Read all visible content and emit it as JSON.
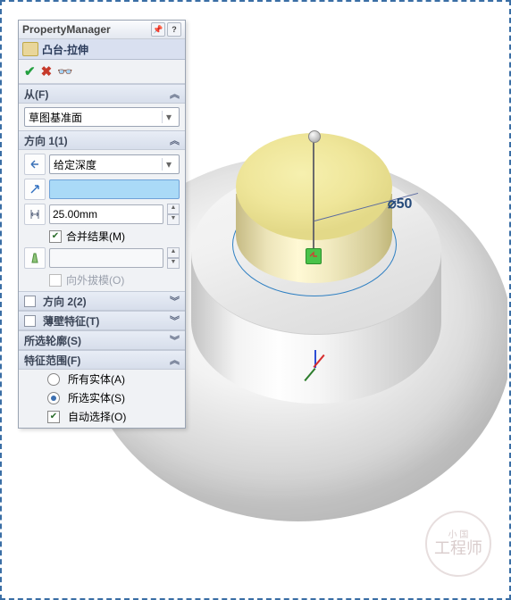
{
  "header": {
    "title": "PropertyManager"
  },
  "feature": {
    "title": "凸台-拉伸"
  },
  "from": {
    "label": "从(F)",
    "selected": "草图基准面"
  },
  "dir1": {
    "label": "方向 1(1)",
    "end_condition": "给定深度",
    "distance": "25.00mm",
    "offset_value": "",
    "merge_label": "合并结果(M)",
    "draft_label": "向外拔模(O)"
  },
  "dir2": {
    "label": "方向 2(2)"
  },
  "thin": {
    "label": "薄壁特征(T)"
  },
  "contours": {
    "label": "所选轮廓(S)"
  },
  "scope": {
    "label": "特征范围(F)",
    "all_bodies": "所有实体(A)",
    "selected_bodies": "所选实体(S)",
    "auto_select": "自动选择(O)"
  },
  "dimension": {
    "label": "⌀50"
  },
  "watermark": {
    "line1": "小 国",
    "line2": "工程师"
  }
}
